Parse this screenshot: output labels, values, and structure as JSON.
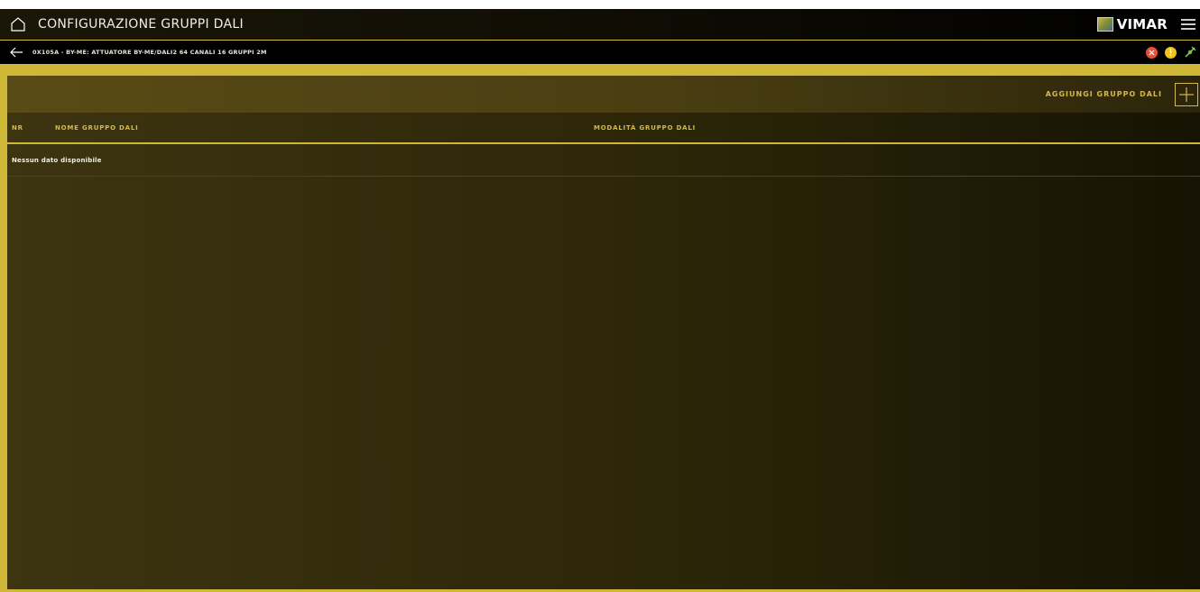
{
  "header": {
    "title": "CONFIGURAZIONE GRUPPI DALI",
    "brand": "VIMAR",
    "icons": {
      "home": "home-icon",
      "menu": "hamburger-menu-icon"
    }
  },
  "subheader": {
    "device": "0X105A - BY-ME: ATTUATORE BY-ME/DALI2 64 CANALI 16 GRUPPI 2M",
    "icons": {
      "back": "back-arrow-icon",
      "status": [
        "error-icon",
        "warning-icon",
        "connection-icon"
      ]
    },
    "colors": {
      "error": "#e8503a",
      "warning": "#f0c419",
      "connection": "#7bc043"
    }
  },
  "toolbar": {
    "add_label": "AGGIUNGI GRUPPO DALI"
  },
  "table": {
    "columns": [
      "NR",
      "NOME GRUPPO DALI",
      "MODALITÀ GRUPPO DALI"
    ],
    "empty_message": "Nessun dato disponibile",
    "rows": []
  },
  "colors": {
    "accent": "#d7b94a",
    "frame": "#cfb838",
    "panel": "#2c2608"
  }
}
